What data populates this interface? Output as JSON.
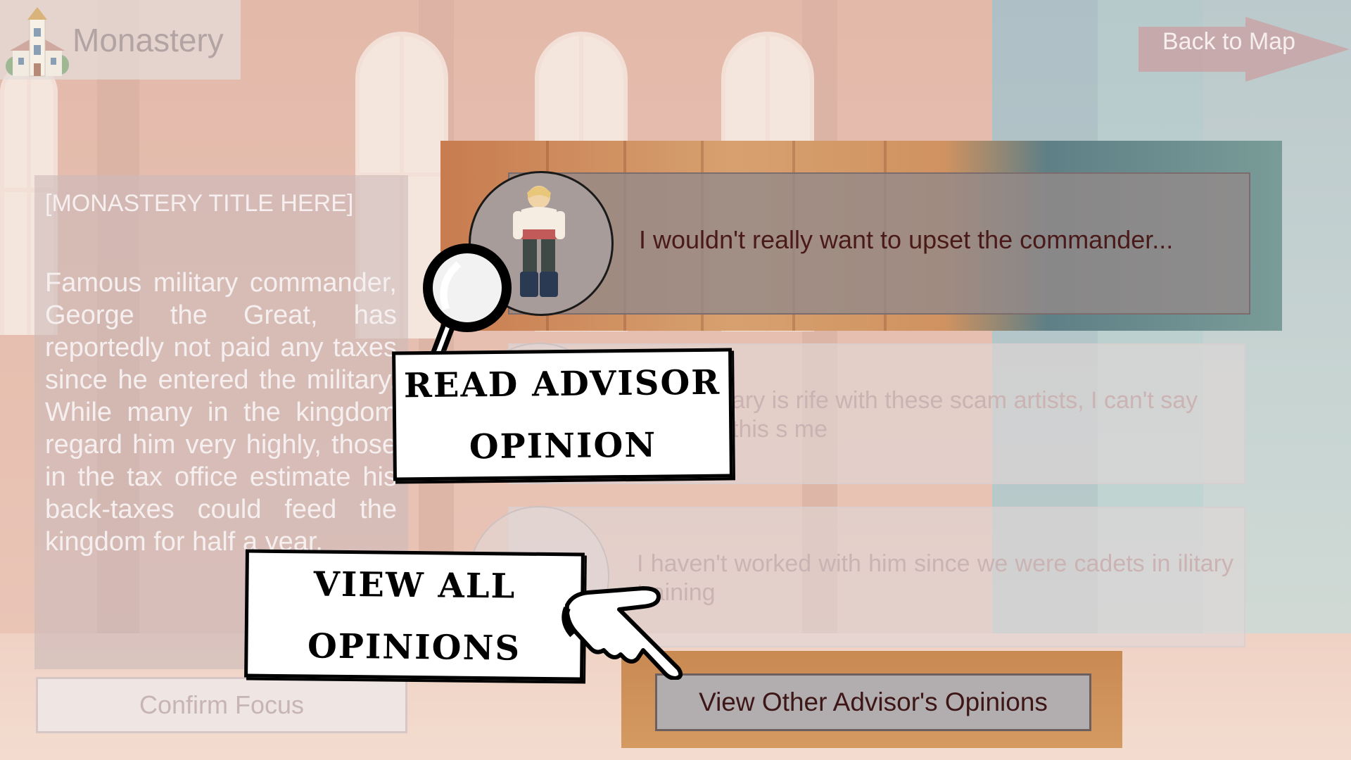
{
  "header": {
    "location_title": "Monastery",
    "back_button_label": "Back to Map"
  },
  "description": {
    "title": "[MONASTERY TITLE HERE]",
    "body": "Famous military commander, George the Great, has reportedly not paid any taxes since he entered the military. While many in the kingdom regard him very highly, those in the tax office estimate his back-taxes could feed the kingdom for half a year.",
    "confirm_button_label": "Confirm Focus"
  },
  "advisors": [
    {
      "opinion": "I wouldn't really want to upset the commander...",
      "active": true
    },
    {
      "opinion": "ary is rife with these scam artists, I can't say this s me",
      "active": false
    },
    {
      "opinion": "I haven't worked with him since we were cadets in ilitary training",
      "active": false
    }
  ],
  "view_others_button_label": "View Other Advisor's Opinions",
  "tutorial": {
    "read_callout": [
      "READ ADVISOR",
      "OPINION"
    ],
    "view_all_callout": [
      "VIEW ALL",
      "OPINIONS"
    ]
  },
  "colors": {
    "active_card": "#948a8a",
    "opinion_text": "#4a1a1a",
    "back_arrow": "#c9a5a5",
    "callout_bg": "#ffffff"
  },
  "icons": [
    "monastery-icon",
    "magnifying-glass-icon",
    "pointing-hand-icon",
    "advisor-portrait"
  ]
}
